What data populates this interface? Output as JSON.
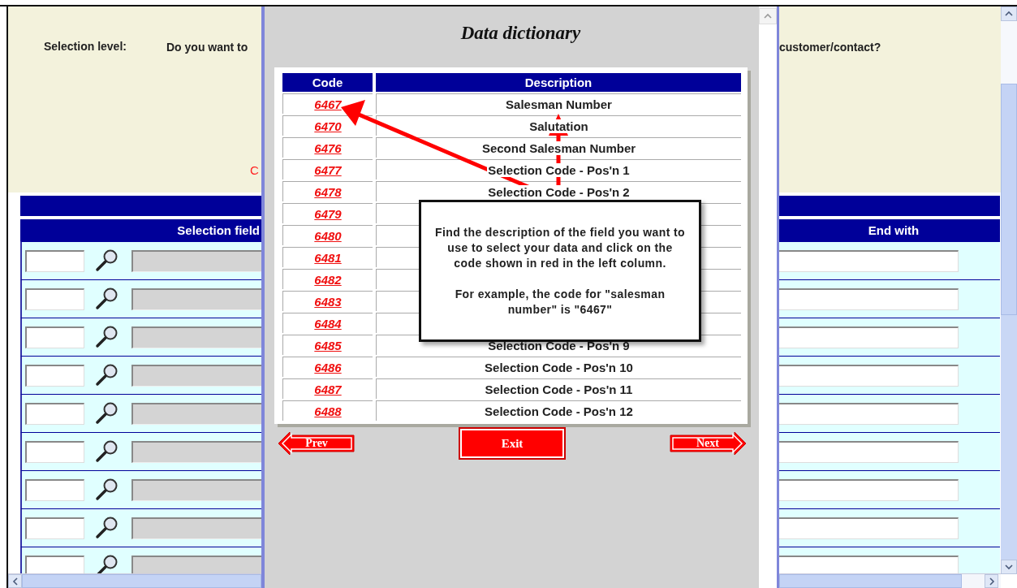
{
  "background_page": {
    "selection_level_label": "Selection level:",
    "question_start": "Do you want to",
    "question_end": "customer/contact?",
    "red_fragment": "C",
    "columns": [
      "Selection field",
      "End with"
    ]
  },
  "dialog": {
    "title": "Data dictionary",
    "columns": [
      "Code",
      "Description"
    ],
    "rows": [
      {
        "code": "6467",
        "description": "Salesman Number"
      },
      {
        "code": "6470",
        "description": "Salutation"
      },
      {
        "code": "6476",
        "description": "Second Salesman Number"
      },
      {
        "code": "6477",
        "description": "Selection Code - Pos'n 1"
      },
      {
        "code": "6478",
        "description": "Selection Code - Pos'n 2"
      },
      {
        "code": "6479"
      },
      {
        "code": "6480"
      },
      {
        "code": "6481"
      },
      {
        "code": "6482"
      },
      {
        "code": "6483"
      },
      {
        "code": "6484"
      },
      {
        "code": "6485",
        "description": "Selection Code - Pos'n 9"
      },
      {
        "code": "6486",
        "description": "Selection Code - Pos'n 10"
      },
      {
        "code": "6487",
        "description": "Selection Code - Pos'n 11"
      },
      {
        "code": "6488",
        "description": "Selection Code - Pos'n 12"
      }
    ],
    "callout": [
      "Find the description of the field you want to use to select your data and click on the code shown in red in the left column.",
      "For example, the code for \"salesman number\" is \"6467\""
    ],
    "buttons": [
      {
        "label": "Prev",
        "kind": "back"
      },
      {
        "label": "Exit",
        "kind": "plain"
      },
      {
        "label": "Next",
        "kind": "forward"
      }
    ]
  }
}
